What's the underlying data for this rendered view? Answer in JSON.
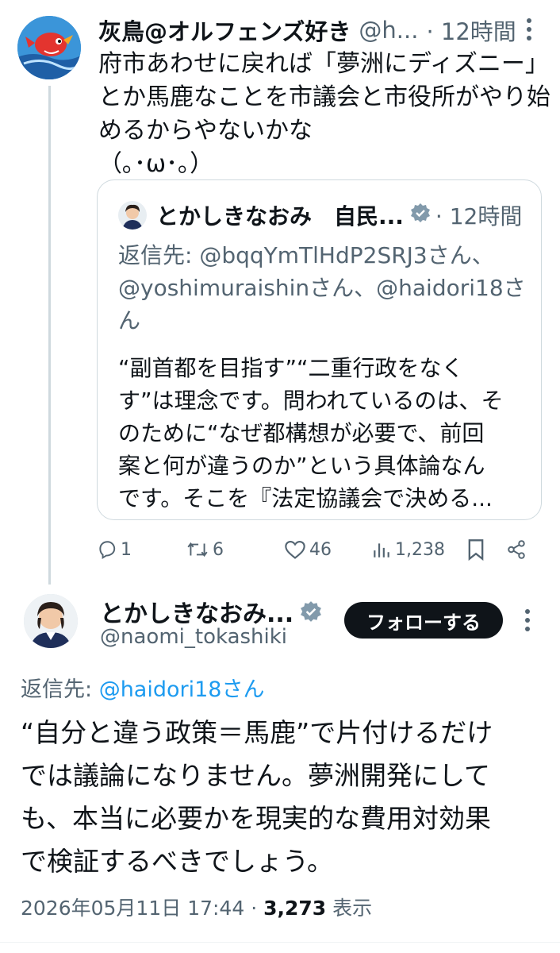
{
  "parent_tweet": {
    "display_name": "灰鳥@オルフェンズ好き",
    "handle": "@h...",
    "time": "· 12時間",
    "lines": [
      "府市あわせに戻れば「夢洲にディズニー」",
      "とか馬鹿なことを市議会と市役所がやり始",
      "めるからやないかな",
      "（｡･ω･｡）"
    ]
  },
  "quote": {
    "display_name": "とかしきなおみ　自民...",
    "time": "· 12時間",
    "reply_lines": [
      "返信先: @bqqYmTlHdP2SRJ3さん、",
      "@yoshimuraishinさん、@haidori18さ",
      "ん"
    ],
    "body_lines": [
      "“副首都を目指す”“二重行政をなく",
      "す”は理念です。問われているのは、そ",
      "のために“なぜ都構想が必要で、前回",
      "案と何が違うのか”という具体論なん",
      "です。そこを『法定協議会で決める..."
    ]
  },
  "actions": {
    "reply_count": "1",
    "retweet_count": "6",
    "like_count": "46",
    "view_count": "1,238"
  },
  "main_tweet": {
    "display_name": "とかしきなおみ...",
    "handle": "@naomi_tokashiki",
    "follow_label": "フォローする",
    "reply_prefix": "返信先: ",
    "reply_mention": "@haidori18さん",
    "body_lines": [
      "“自分と違う政策＝馬鹿”で片付けるだけ",
      "では議論になりません。夢洲開発にして",
      "も、本当に必要かを現実的な費用対効果",
      "で検証するべきでしょう。"
    ],
    "timestamp": "2026年05月11日 17:44",
    "separator": " · ",
    "views_count": "3,273",
    "views_label": " 表示"
  },
  "colors": {
    "text": "#0f1419",
    "secondary": "#536471",
    "accent": "#1d9bf0",
    "border": "#cfd9de"
  }
}
